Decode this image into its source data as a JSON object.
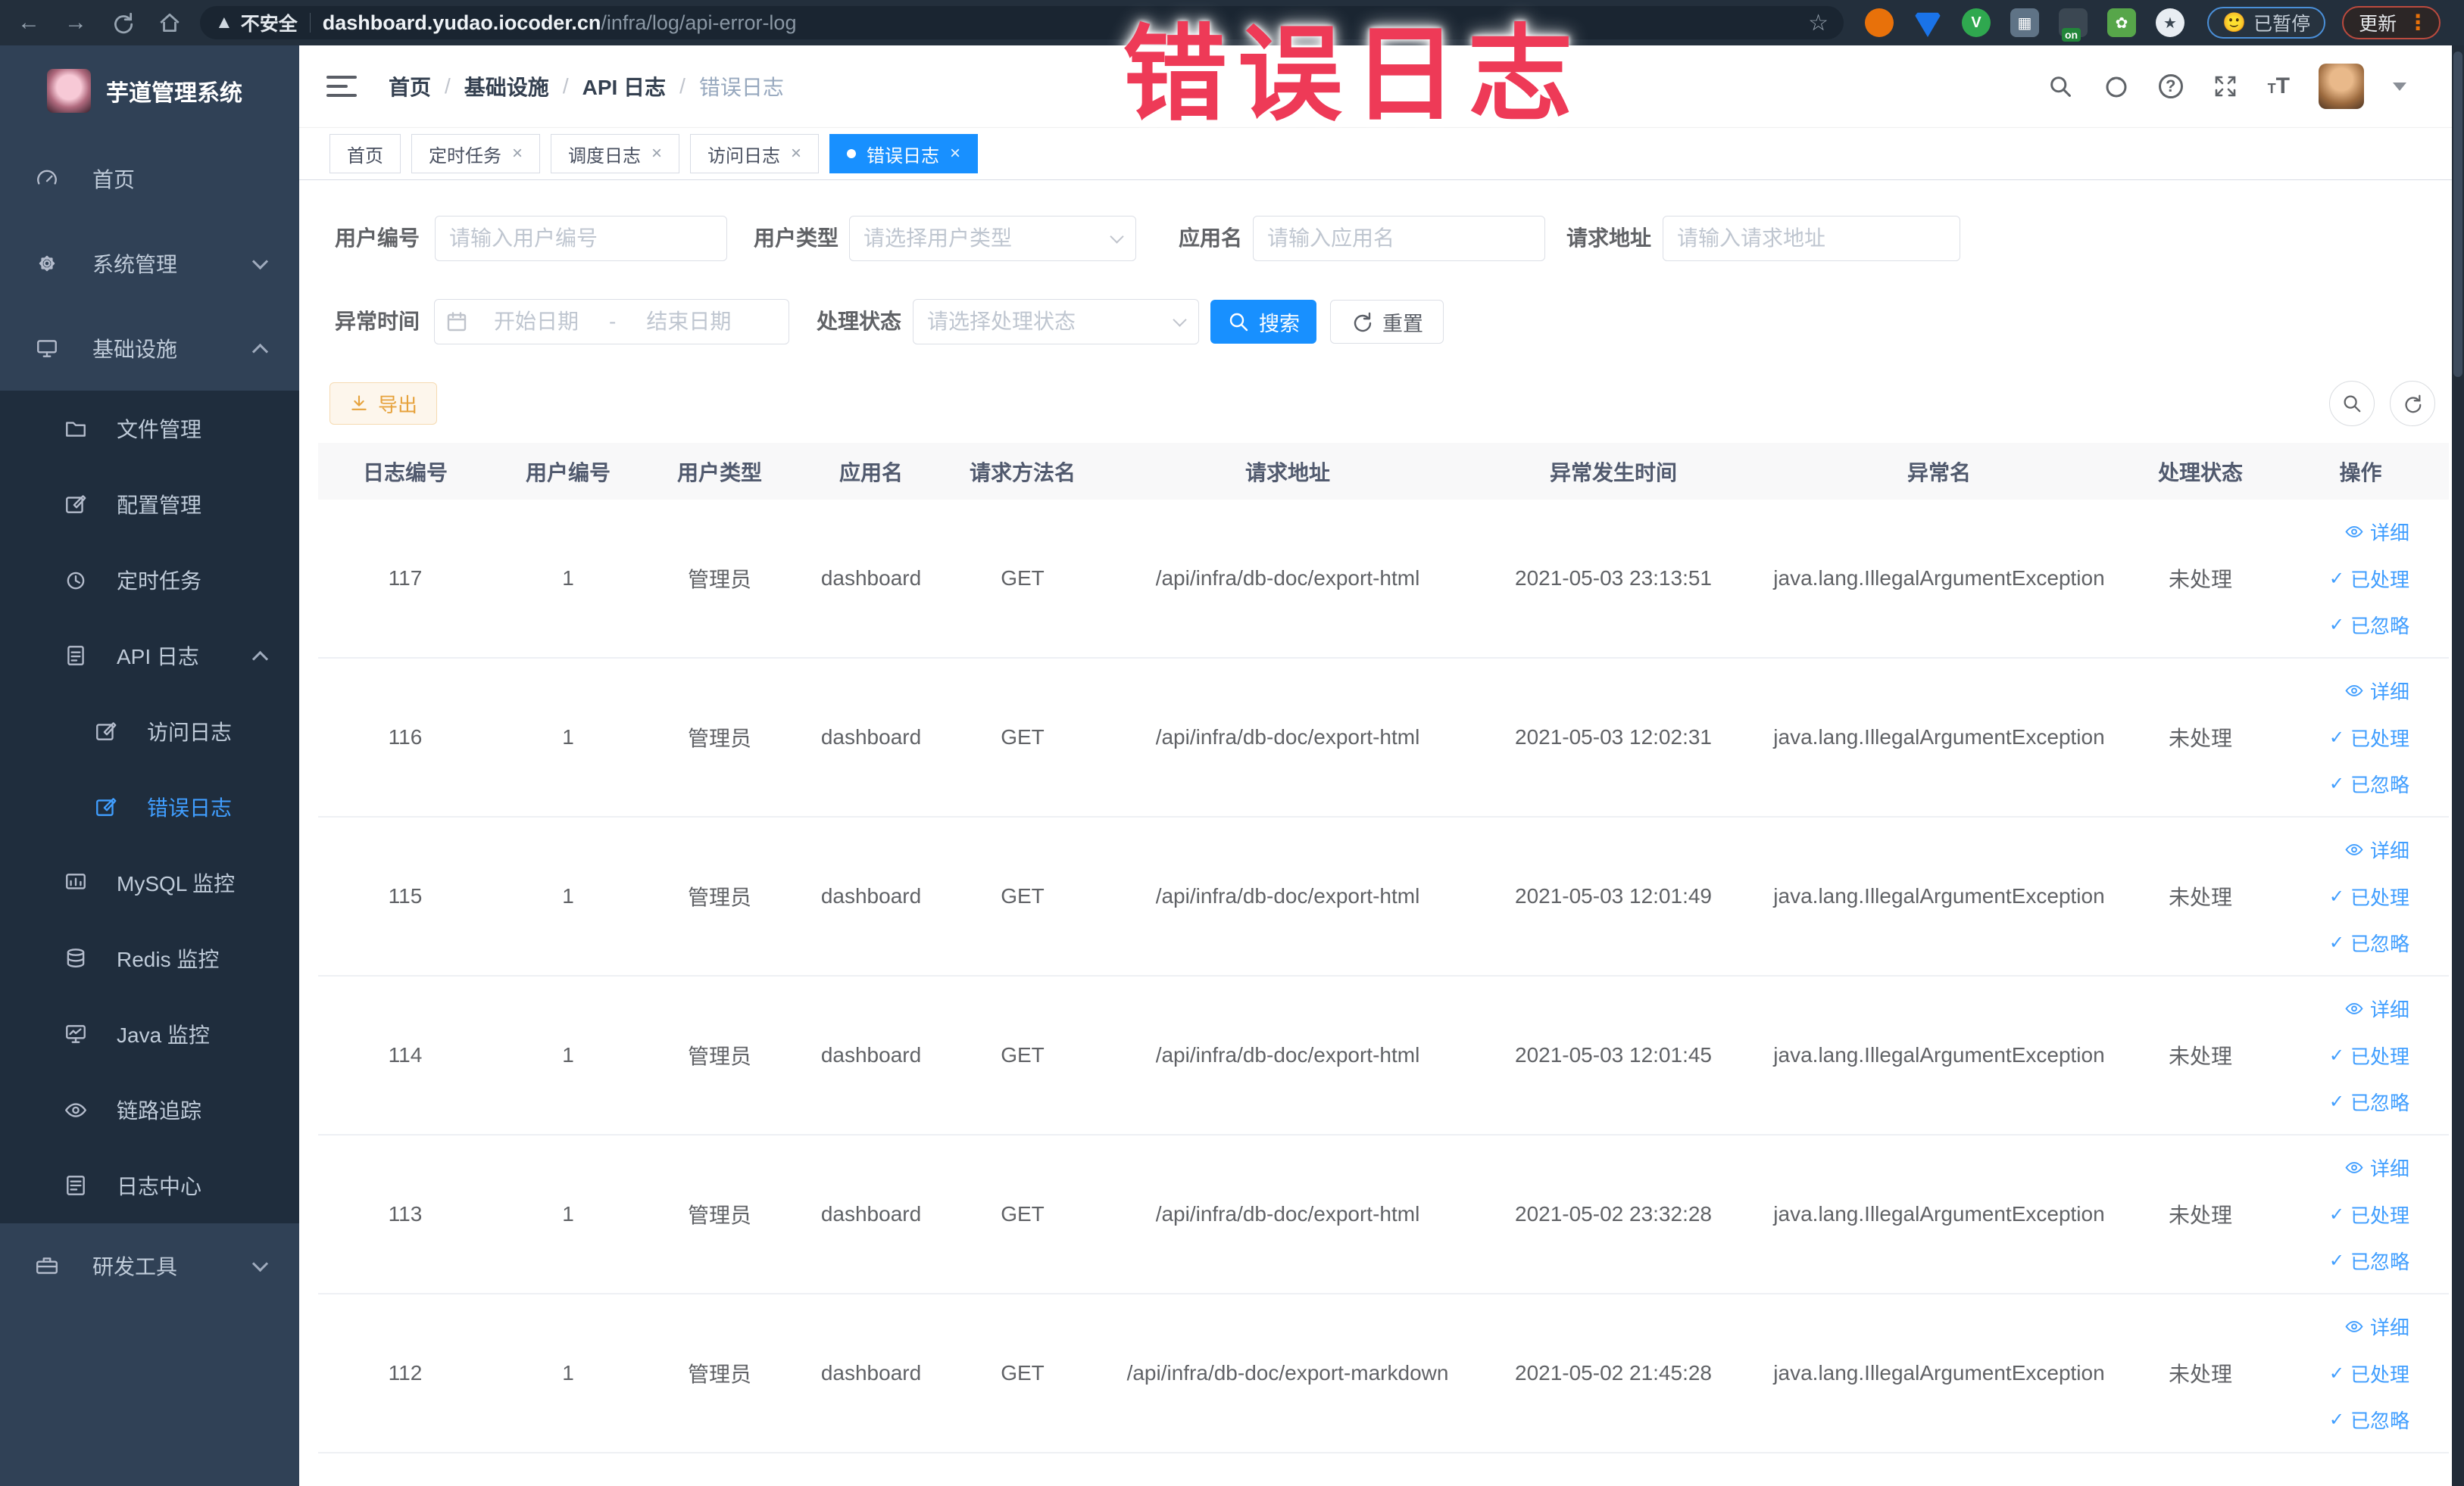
{
  "annotation": {
    "text": "错误日志"
  },
  "browser": {
    "security_label": "不安全",
    "url_host": "dashboard.yudao.iocoder.cn",
    "url_path": "/infra/log/api-error-log",
    "paused_label": "已暂停",
    "update_label": "更新",
    "ext_on_badge": "on"
  },
  "sidebar": {
    "logo_title": "芋道管理系统",
    "items": [
      {
        "label": "首页"
      },
      {
        "label": "系统管理"
      },
      {
        "label": "基础设施",
        "children": [
          {
            "label": "文件管理"
          },
          {
            "label": "配置管理"
          },
          {
            "label": "定时任务"
          },
          {
            "label": "API 日志",
            "children": [
              {
                "label": "访问日志"
              },
              {
                "label": "错误日志",
                "active": true
              }
            ]
          },
          {
            "label": "MySQL 监控"
          },
          {
            "label": "Redis 监控"
          },
          {
            "label": "Java 监控"
          },
          {
            "label": "链路追踪"
          },
          {
            "label": "日志中心"
          }
        ]
      },
      {
        "label": "研发工具"
      }
    ]
  },
  "header": {
    "breadcrumb": [
      {
        "label": "首页"
      },
      {
        "label": "基础设施"
      },
      {
        "label": "API 日志"
      },
      {
        "label": "错误日志"
      }
    ]
  },
  "tags_view": {
    "tabs": [
      {
        "label": "首页"
      },
      {
        "label": "定时任务"
      },
      {
        "label": "调度日志"
      },
      {
        "label": "访问日志"
      },
      {
        "label": "错误日志"
      }
    ]
  },
  "filters": {
    "user_id": {
      "label": "用户编号",
      "placeholder": "请输入用户编号"
    },
    "user_type": {
      "label": "用户类型",
      "placeholder": "请选择用户类型"
    },
    "app_name": {
      "label": "应用名",
      "placeholder": "请输入应用名"
    },
    "request_url": {
      "label": "请求地址",
      "placeholder": "请输入请求地址"
    },
    "exception_time": {
      "label": "异常时间",
      "start_placeholder": "开始日期",
      "separator": "-",
      "end_placeholder": "结束日期"
    },
    "process_status": {
      "label": "处理状态",
      "placeholder": "请选择处理状态"
    },
    "search_label": "搜索",
    "reset_label": "重置"
  },
  "toolbar": {
    "export_label": "导出"
  },
  "table": {
    "headers": [
      "日志编号",
      "用户编号",
      "用户类型",
      "应用名",
      "请求方法名",
      "请求地址",
      "异常发生时间",
      "异常名",
      "处理状态",
      "操作"
    ],
    "action_labels": {
      "detail": "详细",
      "processed": "已处理",
      "ignored": "已忽略"
    },
    "rows": [
      {
        "id": "117",
        "user_id": "1",
        "user_type": "管理员",
        "app": "dashboard",
        "method": "GET",
        "url": "/api/infra/db-doc/export-html",
        "time": "2021-05-03 23:13:51",
        "exception": "java.lang.IllegalArgumentException",
        "status": "未处理"
      },
      {
        "id": "116",
        "user_id": "1",
        "user_type": "管理员",
        "app": "dashboard",
        "method": "GET",
        "url": "/api/infra/db-doc/export-html",
        "time": "2021-05-03 12:02:31",
        "exception": "java.lang.IllegalArgumentException",
        "status": "未处理"
      },
      {
        "id": "115",
        "user_id": "1",
        "user_type": "管理员",
        "app": "dashboard",
        "method": "GET",
        "url": "/api/infra/db-doc/export-html",
        "time": "2021-05-03 12:01:49",
        "exception": "java.lang.IllegalArgumentException",
        "status": "未处理"
      },
      {
        "id": "114",
        "user_id": "1",
        "user_type": "管理员",
        "app": "dashboard",
        "method": "GET",
        "url": "/api/infra/db-doc/export-html",
        "time": "2021-05-03 12:01:45",
        "exception": "java.lang.IllegalArgumentException",
        "status": "未处理"
      },
      {
        "id": "113",
        "user_id": "1",
        "user_type": "管理员",
        "app": "dashboard",
        "method": "GET",
        "url": "/api/infra/db-doc/export-html",
        "time": "2021-05-02 23:32:28",
        "exception": "java.lang.IllegalArgumentException",
        "status": "未处理"
      },
      {
        "id": "112",
        "user_id": "1",
        "user_type": "管理员",
        "app": "dashboard",
        "method": "GET",
        "url": "/api/infra/db-doc/export-markdown",
        "time": "2021-05-02 21:45:28",
        "exception": "java.lang.IllegalArgumentException",
        "status": "未处理"
      }
    ]
  },
  "colors": {
    "primary": "#1890ff",
    "link": "#409eff",
    "warning": "#e6a23c",
    "sidebar_bg": "#304156",
    "submenu_bg": "#1f2d3d",
    "annotation": "#ee3a57"
  }
}
